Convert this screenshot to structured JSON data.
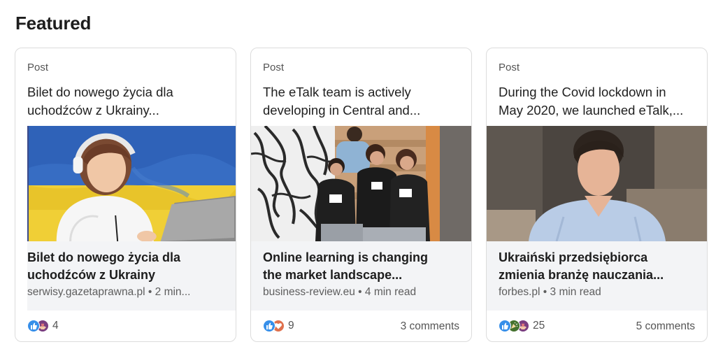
{
  "section": {
    "title": "Featured"
  },
  "cards": [
    {
      "post_type": "Post",
      "excerpt_line1": "Bilet do nowego życia dla",
      "excerpt_line2": "uchodźców z Ukrainy...",
      "article_title_line1": "Bilet do nowego życia dla",
      "article_title_line2": "uchodźców z Ukrainy",
      "meta_source": "serwisy.gazetaprawna.pl",
      "meta_sep": "•",
      "meta_read": "2 min...",
      "reaction_count": "4",
      "comments": "",
      "reactions": [
        "like-icon",
        "support-icon"
      ]
    },
    {
      "post_type": "Post",
      "excerpt_line1": "The eTalk team is actively",
      "excerpt_line2": "developing in Central and...",
      "article_title_line1": "Online learning is changing",
      "article_title_line2": "the market landscape...",
      "meta_source": "business-review.eu",
      "meta_sep": "•",
      "meta_read": "4 min read",
      "reaction_count": "9",
      "comments": "3 comments",
      "reactions": [
        "like-icon",
        "love-icon"
      ]
    },
    {
      "post_type": "Post",
      "excerpt_line1": "During the Covid lockdown in",
      "excerpt_line2": "May 2020, we launched eTalk,...",
      "article_title_line1": "Ukraiński przedsiębiorca",
      "article_title_line2": "zmienia branżę nauczania...",
      "meta_source": "forbes.pl",
      "meta_sep": "•",
      "meta_read": "3 min read",
      "reaction_count": "25",
      "comments": "5 comments",
      "reactions": [
        "like-icon",
        "celebrate-icon",
        "support-icon"
      ]
    }
  ],
  "colors": {
    "like": "#378fe9",
    "love": "#df704d",
    "celebrate": "#44712e",
    "support": "#7a3e7f",
    "ukraine_blue": "#2d5fb6",
    "ukraine_yellow": "#f2d33b"
  }
}
